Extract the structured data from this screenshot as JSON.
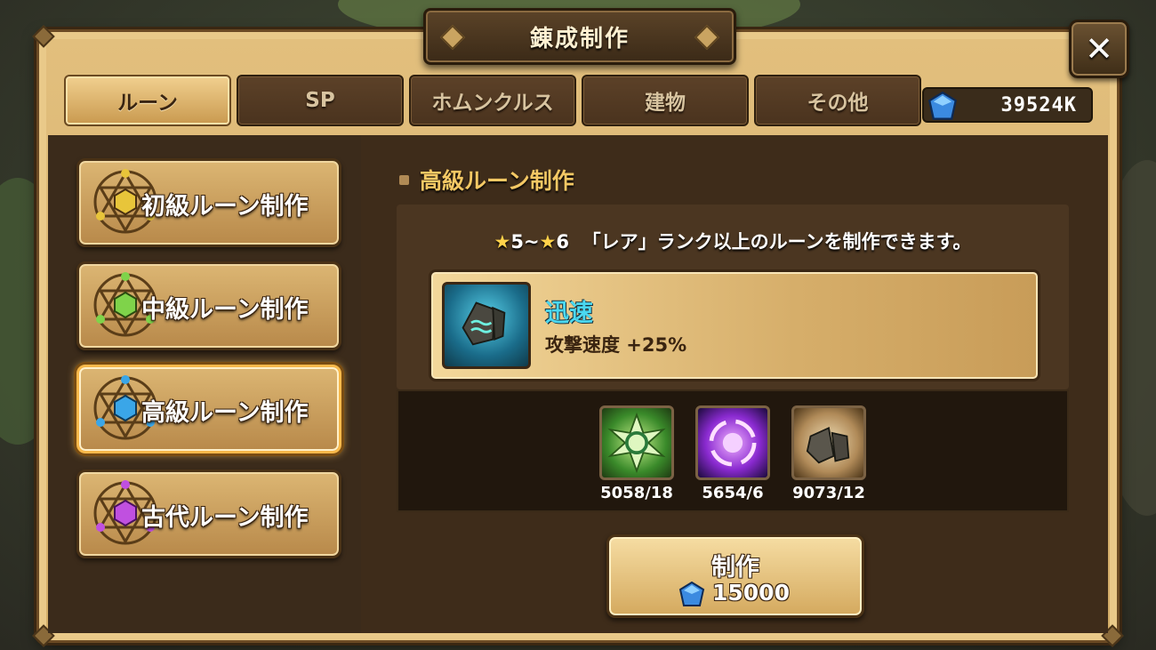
{
  "window": {
    "title": "錬成制作",
    "close_label": "✕"
  },
  "tabs": [
    {
      "label": "ルーン",
      "active": true
    },
    {
      "label": "SP",
      "active": false
    },
    {
      "label": "ホムンクルス",
      "active": false
    },
    {
      "label": "建物",
      "active": false
    },
    {
      "label": "その他",
      "active": false
    }
  ],
  "currency": {
    "icon": "crystal-icon",
    "value": "39524K"
  },
  "recipes": [
    {
      "label": "初級ルーン制作",
      "gem_color": "#e8c53a",
      "active": false
    },
    {
      "label": "中級ルーン制作",
      "gem_color": "#7fd34a",
      "active": false
    },
    {
      "label": "高級ルーン制作",
      "gem_color": "#3aa6e8",
      "active": true
    },
    {
      "label": "古代ルーン制作",
      "gem_color": "#c050e0",
      "active": false
    }
  ],
  "detail": {
    "section_title": "高級ルーン制作",
    "star_min": "5~",
    "star_max": "6",
    "description": "「レア」ランク以上のルーンを制作できます。",
    "rune": {
      "name": "迅速",
      "effect": "攻撃速度 +25%",
      "icon": "swift-rune-icon"
    }
  },
  "materials": [
    {
      "icon": "wind-essence-icon",
      "count": "5058/18"
    },
    {
      "icon": "chaos-essence-icon",
      "count": "5654/6"
    },
    {
      "icon": "rune-stone-icon",
      "count": "9073/12"
    }
  ],
  "craft": {
    "label": "制作",
    "cost": "15000",
    "cost_icon": "crystal-icon"
  },
  "colors": {
    "accent": "#f4c864",
    "rune_name": "#4ad8f0"
  }
}
